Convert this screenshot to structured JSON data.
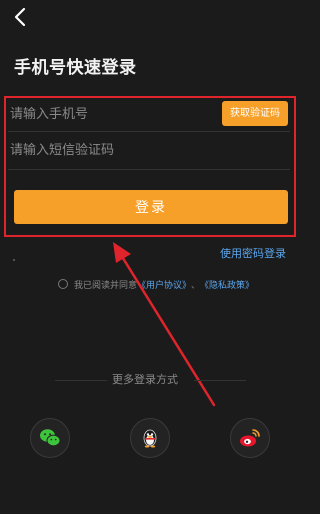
{
  "header": {
    "back_icon": "chevron-left-icon",
    "title": "手机号快速登录"
  },
  "form": {
    "phone_placeholder": "请输入手机号",
    "get_code_label": "获取验证码",
    "sms_placeholder": "请输入短信验证码",
    "login_label": "登录"
  },
  "links": {
    "password_login": "使用密码登录"
  },
  "agreement": {
    "prefix": "我已阅读并同意",
    "user_agreement": "《用户协议》",
    "separator": "、",
    "privacy_policy": "《隐私政策》"
  },
  "more": {
    "label": "更多登录方式",
    "options": [
      {
        "name": "wechat",
        "icon": "wechat-icon",
        "color": "#3ec43c"
      },
      {
        "name": "qq",
        "icon": "qq-penguin-icon",
        "color": "#f5f5f5"
      },
      {
        "name": "weibo",
        "icon": "weibo-icon",
        "color": "#e6162d"
      }
    ]
  },
  "colors": {
    "accent": "#f6a02a",
    "link": "#5aa6ee",
    "highlight": "#e0242c",
    "background": "#1b1b1b"
  }
}
